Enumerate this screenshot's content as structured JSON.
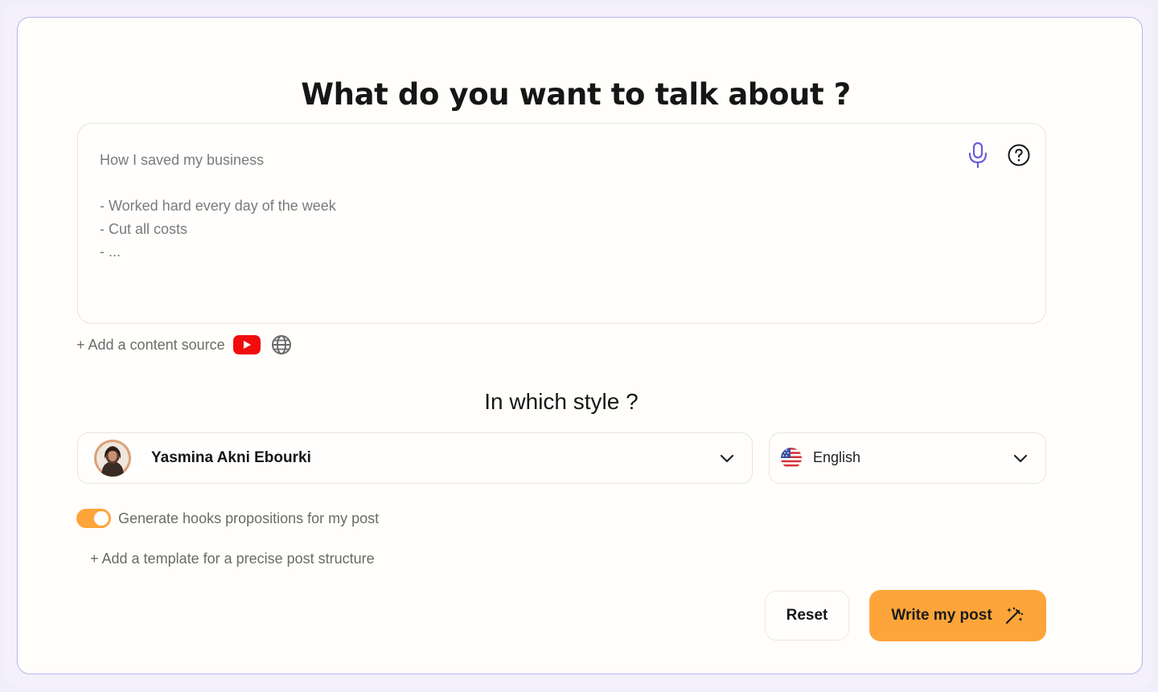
{
  "title": "What do you want to talk about ?",
  "topic": {
    "value": "How I saved my business\n\n- Worked hard every day of the week\n- Cut all costs\n- ..."
  },
  "content_source": {
    "label": "+ Add a content source"
  },
  "style_section": {
    "title": "In which style ?",
    "selected_style": "Yasmina Akni Ebourki",
    "selected_language": "English"
  },
  "hooks_toggle": {
    "label": "Generate hooks propositions for my post",
    "enabled": true
  },
  "template_link": "+ Add a template for a precise post structure",
  "actions": {
    "reset_label": "Reset",
    "write_label": "Write my post"
  },
  "colors": {
    "accent": "#fda53a",
    "mic": "#6a5ed8",
    "card_border": "#b9b3ec",
    "youtube": "#f00d0d"
  }
}
